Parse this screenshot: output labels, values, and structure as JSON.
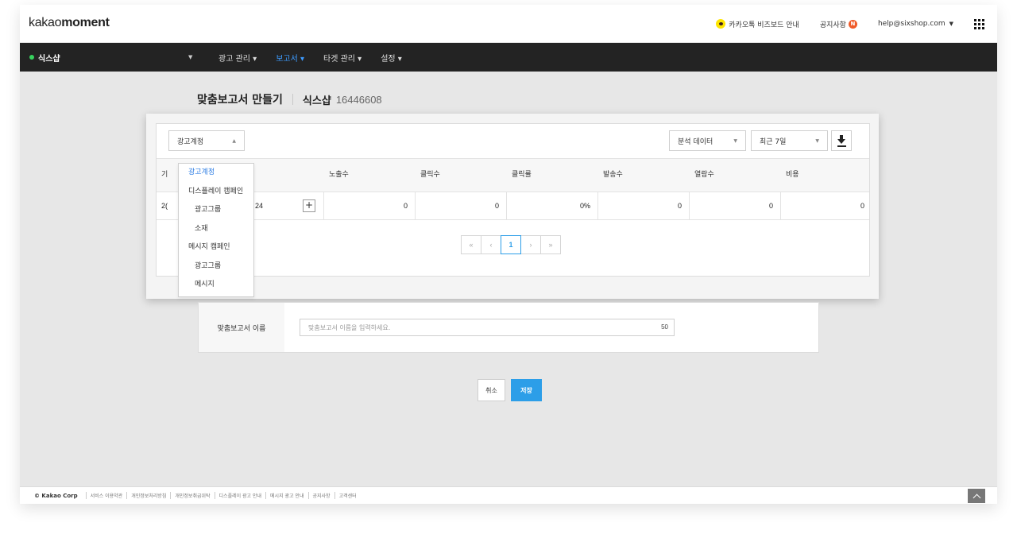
{
  "header": {
    "logo_light": "kakao",
    "logo_bold": "moment",
    "bizboard_link": "카카오톡 비즈보드 안내",
    "notice_link": "공지사항",
    "notice_badge": "N",
    "user_email": "help@sixshop.com",
    "user_caret": "▼"
  },
  "nav": {
    "account": "식스샵",
    "account_caret": "▼",
    "items": [
      {
        "label": "광고 관리 ▾"
      },
      {
        "label": "보고서 ▾"
      },
      {
        "label": "타겟 관리 ▾"
      },
      {
        "label": "설정 ▾"
      }
    ]
  },
  "page": {
    "title": "맞춤보고서 만들기",
    "account_name": "식스샵",
    "account_id": "16446608"
  },
  "report": {
    "level_select": "광고계정",
    "level_caret": "▲",
    "data_select": "분석 데이터",
    "period_select": "최근 7일",
    "select_caret": "▼",
    "columns": [
      "노출수",
      "클릭수",
      "클릭률",
      "발송수",
      "열람수",
      "비용"
    ],
    "row_partial_first": "2(",
    "row_partial_name": "24",
    "col_partial": "기",
    "plus": "+",
    "row_values": [
      "0",
      "0",
      "0%",
      "0",
      "0",
      "0"
    ],
    "pager": {
      "first": "«",
      "prev": "‹",
      "current": "1",
      "next": "›",
      "last": "»"
    }
  },
  "dropdown": {
    "items": [
      {
        "label": "광고계정"
      },
      {
        "label": "디스플레이 캠페인"
      },
      {
        "label": "광고그룹"
      },
      {
        "label": "소재"
      },
      {
        "label": "메시지 캠페인"
      },
      {
        "label": "광고그룹"
      },
      {
        "label": "메시지"
      }
    ]
  },
  "name_form": {
    "label": "맞춤보고서 이름",
    "placeholder": "맞춤보고서 이름을 입력하세요.",
    "max_count": "50"
  },
  "actions": {
    "cancel": "취소",
    "save": "저장"
  },
  "footer": {
    "copyright": "© Kakao Corp",
    "links": [
      "서비스 이용약관",
      "개인정보처리방침",
      "개인정보취급위탁",
      "디스플레이 광고 안내",
      "메시지 광고 안내",
      "공지사항",
      "고객센터"
    ]
  },
  "colors": {
    "accent": "#2c9ee8",
    "nav_bg": "#232323",
    "nav_active": "#3d9bff",
    "status_green": "#37d15e"
  }
}
